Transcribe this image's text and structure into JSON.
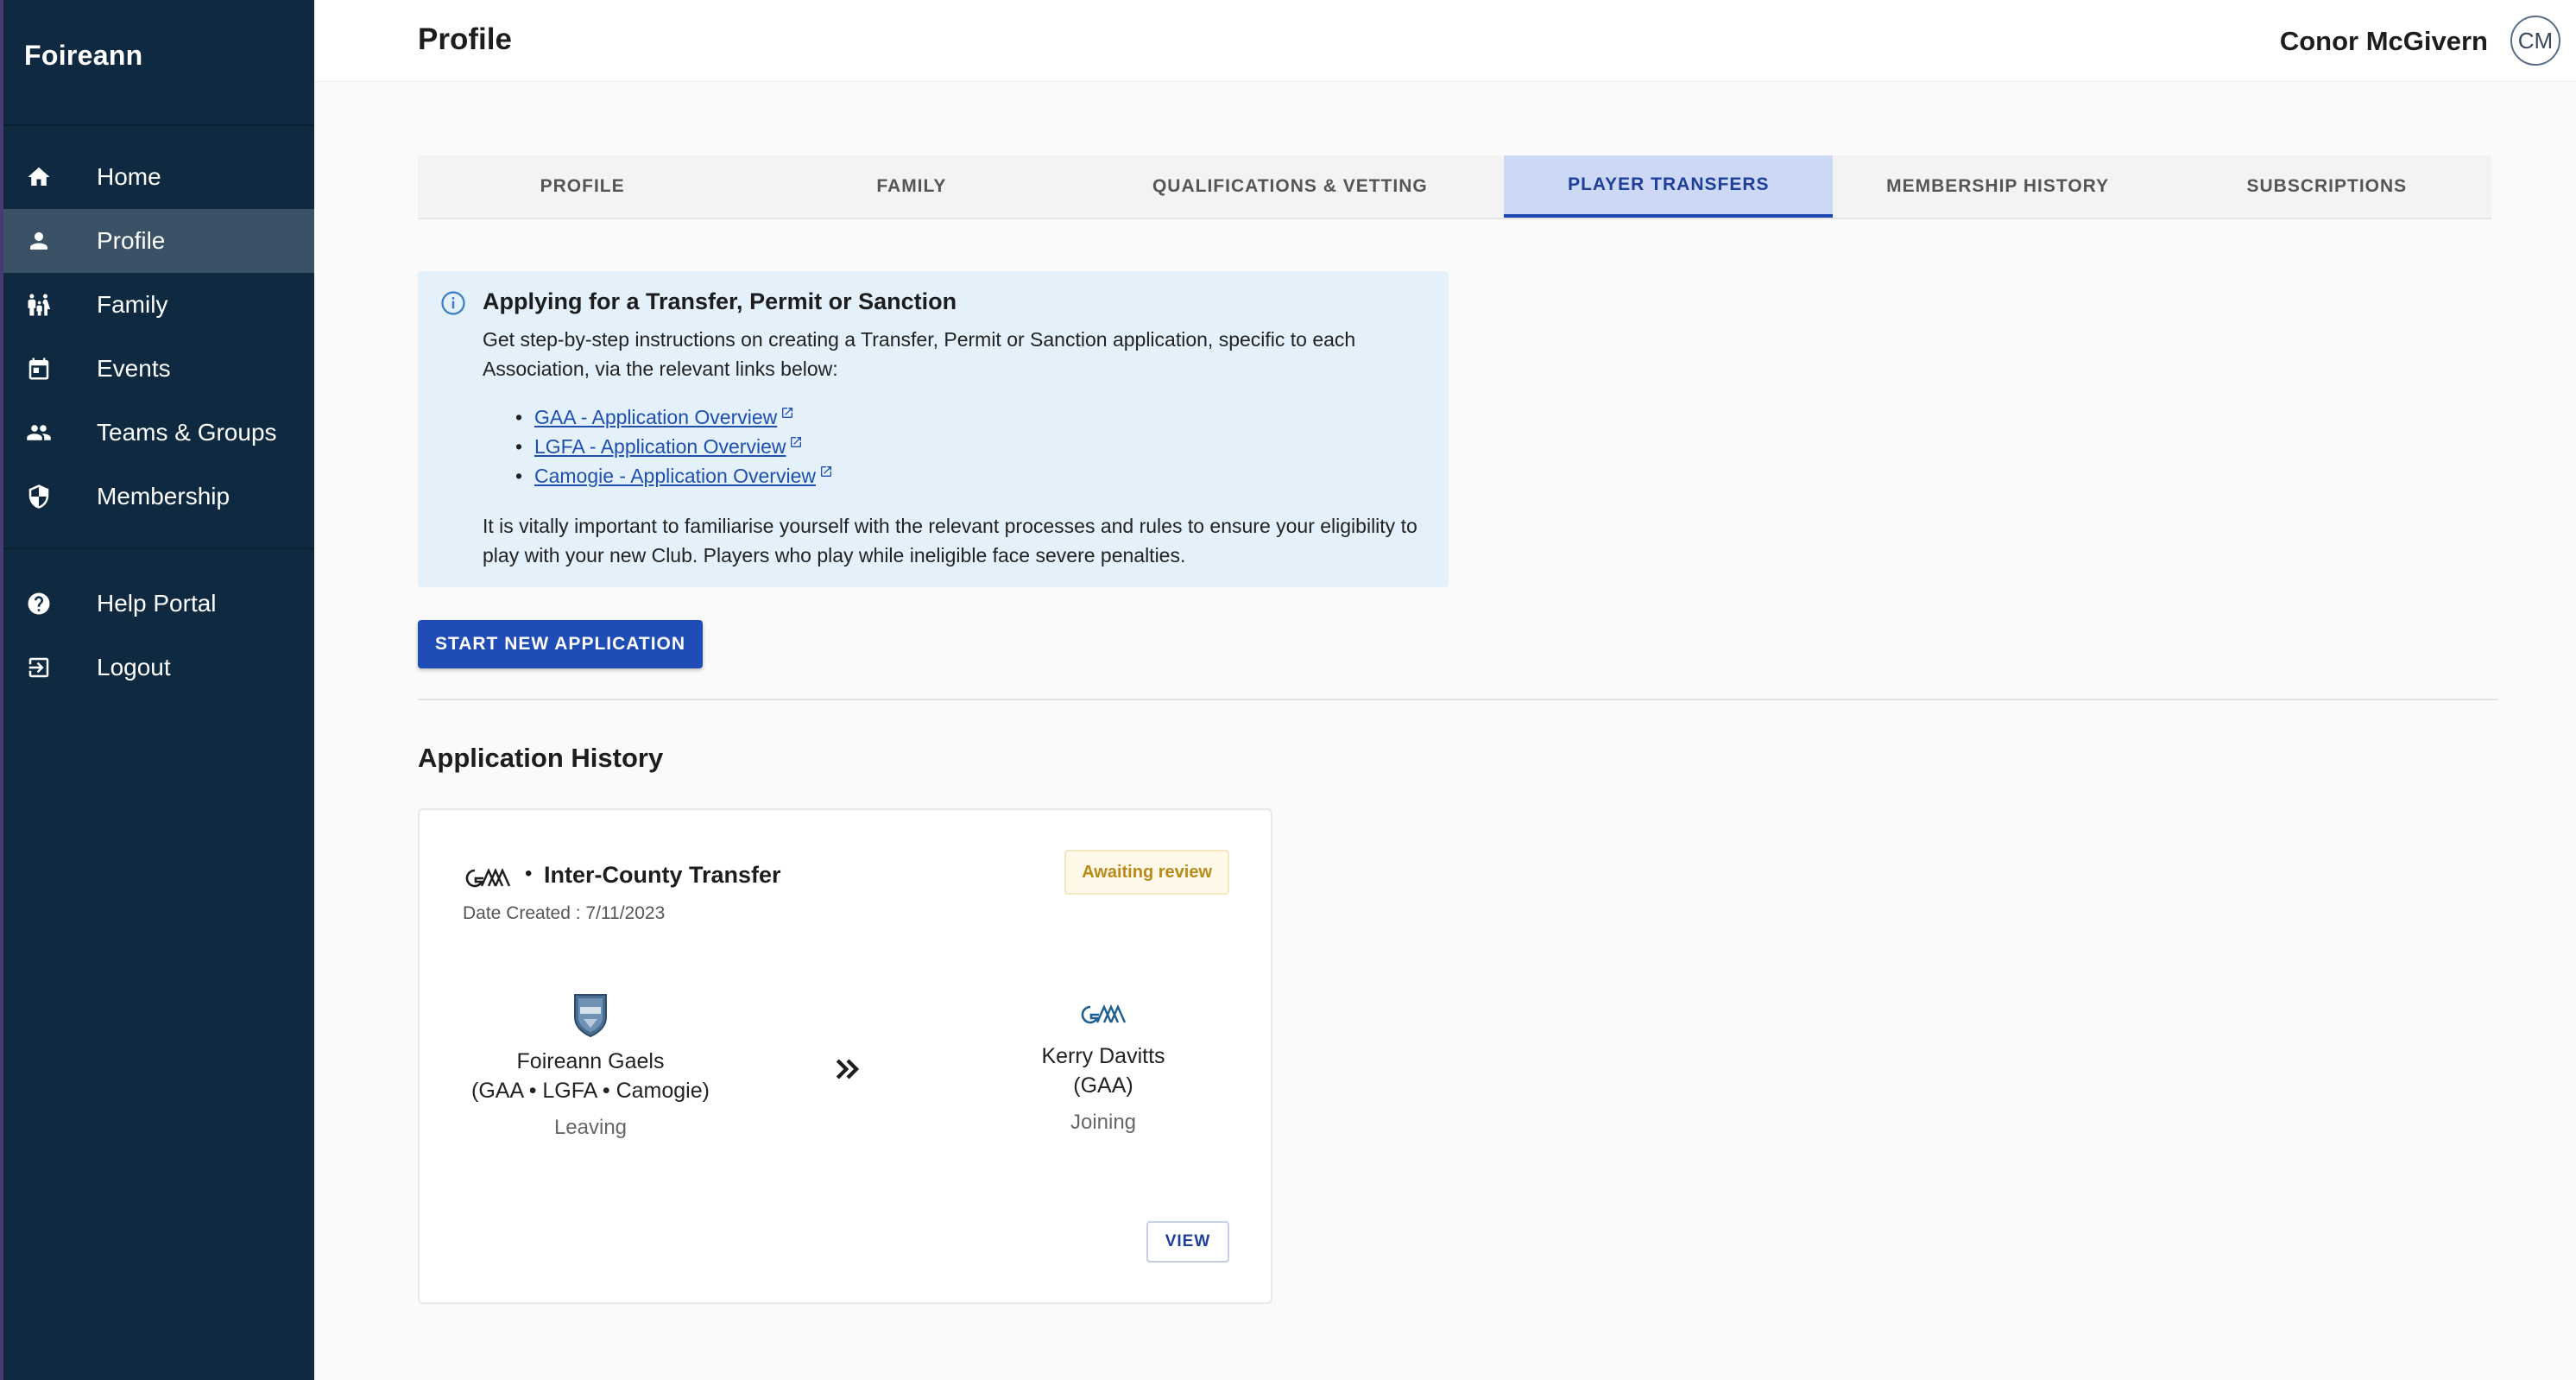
{
  "app": {
    "brand": "Foireann"
  },
  "sidebar": {
    "items": [
      {
        "label": "Home",
        "icon": "home-icon"
      },
      {
        "label": "Profile",
        "icon": "person-icon",
        "active": true
      },
      {
        "label": "Family",
        "icon": "family-icon"
      },
      {
        "label": "Events",
        "icon": "calendar-icon"
      },
      {
        "label": "Teams & Groups",
        "icon": "group-icon"
      },
      {
        "label": "Membership",
        "icon": "shield-icon"
      }
    ],
    "secondary": [
      {
        "label": "Help Portal",
        "icon": "help-icon"
      },
      {
        "label": "Logout",
        "icon": "logout-icon"
      }
    ]
  },
  "header": {
    "title": "Profile",
    "user_name": "Conor McGivern",
    "user_initials": "CM"
  },
  "tabs": [
    {
      "label": "PROFILE"
    },
    {
      "label": "FAMILY"
    },
    {
      "label": "QUALIFICATIONS & VETTING"
    },
    {
      "label": "PLAYER TRANSFERS",
      "active": true
    },
    {
      "label": "MEMBERSHIP HISTORY"
    },
    {
      "label": "SUBSCRIPTIONS"
    }
  ],
  "info": {
    "title": "Applying for a Transfer, Permit or Sanction",
    "intro": "Get step-by-step instructions on creating a Transfer, Permit or Sanction application, specific to each Association, via the relevant links below:",
    "links": [
      "GAA - Application Overview",
      "LGFA - Application Overview",
      "Camogie - Application Overview"
    ],
    "note": "It is vitally important to familiarise yourself with the relevant processes and rules to ensure your eligibility to play with your new Club. Players who play while ineligible face severe penalties."
  },
  "actions": {
    "start_label": "START NEW APPLICATION"
  },
  "history": {
    "title": "Application History",
    "card": {
      "separator": "•",
      "type": "Inter-County Transfer",
      "date": "Date Created : 7/11/2023",
      "status": "Awaiting review",
      "from": {
        "name": "Foireann Gaels",
        "assoc": "(GAA • LGFA • Camogie)",
        "status": "Leaving"
      },
      "to": {
        "name": "Kerry Davitts",
        "assoc": "(GAA)",
        "status": "Joining"
      },
      "view_label": "VIEW"
    }
  },
  "colors": {
    "sidebar": "#0f2a40",
    "sidebar_active": "#3a5166",
    "primary": "#1f4db5",
    "tab_active_bg": "#cdd9f4",
    "info_bg": "#e4f1fb",
    "badge_text": "#b88a1a"
  }
}
